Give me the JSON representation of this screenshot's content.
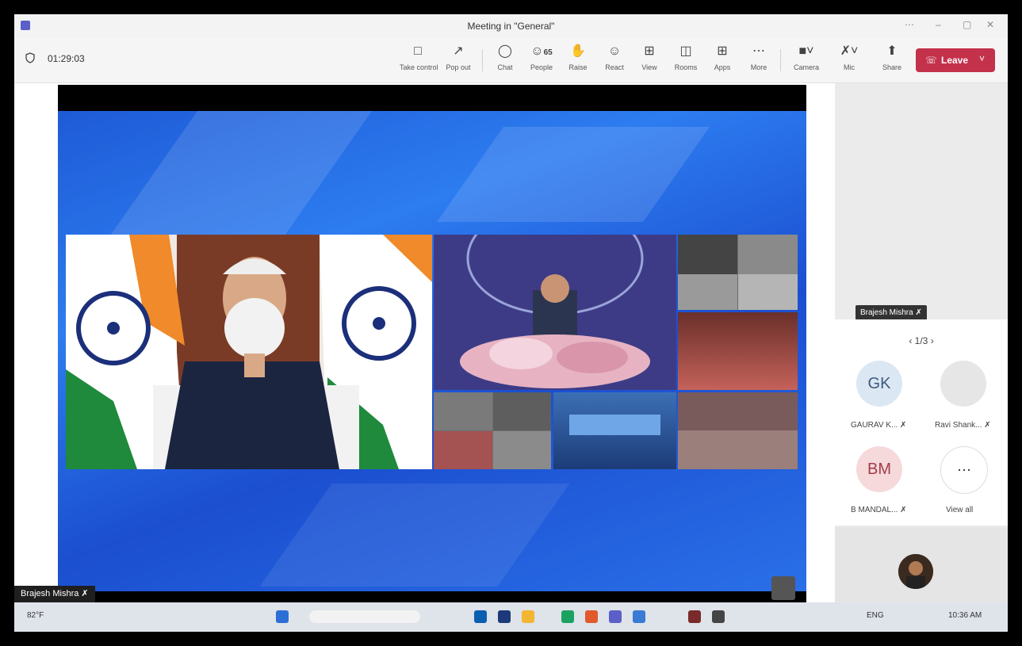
{
  "window": {
    "title": "Meeting in \"General\"",
    "controls": [
      "⋯",
      "–",
      "▢",
      "✕"
    ]
  },
  "toolbar": {
    "timer": "01:29:03",
    "take_control": "Take control",
    "pop_out": "Pop out",
    "chat": "Chat",
    "people": "People",
    "people_count": "65",
    "raise": "Raise",
    "react": "React",
    "view": "View",
    "rooms": "Rooms",
    "apps": "Apps",
    "more": "More",
    "camera": "Camera",
    "mic": "Mic",
    "share": "Share",
    "leave": "Leave"
  },
  "stage": {
    "speaker_name": "Brajesh Mishra"
  },
  "side": {
    "hover_name": "Brajesh Mishra",
    "pager": "1/3",
    "participants": [
      {
        "initials": "GK",
        "name": "GAURAV K...",
        "bg": "#dbe7f3",
        "fg": "#3d5a80"
      },
      {
        "initials": "",
        "name": "Ravi Shank...",
        "bg": "#e6e6e6",
        "fg": "#444"
      },
      {
        "initials": "BM",
        "name": "B MANDAL...",
        "bg": "#f6d9db",
        "fg": "#a23c4a"
      }
    ],
    "view_all": "View all"
  },
  "taskbar": {
    "weather": "82°F",
    "lang": "ENG",
    "time": "10:36 AM"
  },
  "colors": {
    "leave": "#c4314b",
    "stage_blue": "#1e5bd6"
  }
}
